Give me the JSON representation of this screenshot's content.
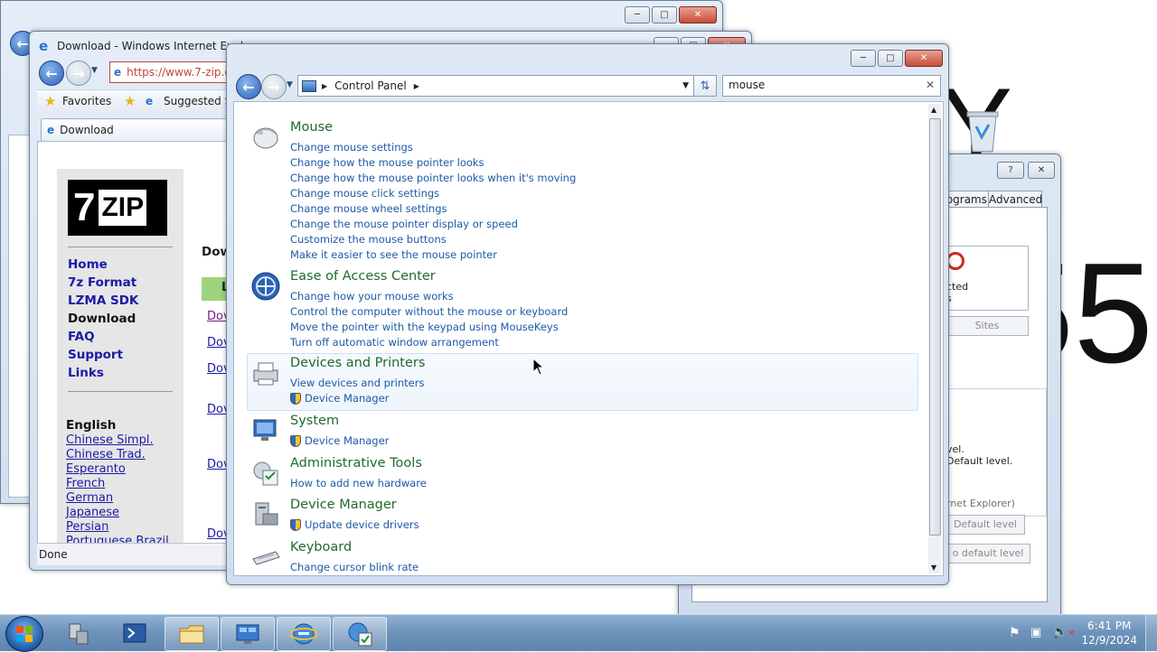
{
  "desktop": {
    "watermark_char_1": "Y",
    "watermark_char_2": "55"
  },
  "back_ie_window": {
    "title": "Download - Windows Internet Explorer"
  },
  "ie_window": {
    "title": "Download - Windows Internet Explorer",
    "address": "https://www.7-zip.o",
    "favorites_label": "Favorites",
    "suggested_label": "Suggested Si",
    "tab_label": "Download",
    "status_text": "Done",
    "page": {
      "heading": "Dow",
      "logo_text_1": "7",
      "logo_text_2": "ZIP",
      "nav": [
        "Home",
        "7z Format",
        "LZMA SDK",
        "Download",
        "FAQ",
        "Support",
        "Links"
      ],
      "language_heading": "English",
      "languages": [
        "Chinese Simpl.",
        "Chinese Trad.",
        "Esperanto",
        "French",
        "German",
        "Japanese",
        "Persian",
        "Portuguese Brazil"
      ],
      "table_header": "L",
      "download_links": [
        "Dov",
        "Dov",
        "Dov",
        "Dov",
        "Dov",
        "Dov"
      ]
    }
  },
  "properties_dialog": {
    "tabs": [
      "ograms",
      "Advanced"
    ],
    "texts": {
      "blocked": "cted",
      "blocked2": "s",
      "sites_button": "Sites",
      "level_1": "vel.",
      "level_2": "Default level.",
      "ie_text": "rnet Explorer)",
      "default_level_button": "Default level",
      "default_level_button2": "o default level"
    }
  },
  "control_panel": {
    "breadcrumb_root": "Control Panel",
    "search_value": "mouse",
    "results": [
      {
        "title": "Mouse",
        "icon": "mouse-icon",
        "links": [
          {
            "text": "Change mouse settings"
          },
          {
            "text": "Change how the mouse pointer looks"
          },
          {
            "text": "Change how the mouse pointer looks when it's moving"
          },
          {
            "text": "Change mouse click settings"
          },
          {
            "text": "Change mouse wheel settings"
          },
          {
            "text": "Change the mouse pointer display or speed"
          },
          {
            "text": "Customize the mouse buttons"
          },
          {
            "text": "Make it easier to see the mouse pointer"
          }
        ]
      },
      {
        "title": "Ease of Access Center",
        "icon": "ease-of-access-icon",
        "links": [
          {
            "text": "Change how your mouse works"
          },
          {
            "text": "Control the computer without the mouse or keyboard"
          },
          {
            "text": "Move the pointer with the keypad using MouseKeys"
          },
          {
            "text": "Turn off automatic window arrangement"
          }
        ]
      },
      {
        "title": "Devices and Printers",
        "icon": "printer-icon",
        "links": [
          {
            "text": "View devices and printers"
          },
          {
            "text": "Device Manager",
            "shield": true
          }
        ]
      },
      {
        "title": "System",
        "icon": "system-icon",
        "links": [
          {
            "text": "Device Manager",
            "shield": true
          }
        ]
      },
      {
        "title": "Administrative Tools",
        "icon": "admin-tools-icon",
        "links": [
          {
            "text": "How to add new hardware"
          }
        ]
      },
      {
        "title": "Device Manager",
        "icon": "device-manager-icon",
        "links": [
          {
            "text": "Update device drivers",
            "shield": true
          }
        ]
      },
      {
        "title": "Keyboard",
        "icon": "keyboard-icon",
        "links": [
          {
            "text": "Change cursor blink rate"
          }
        ]
      }
    ]
  },
  "taskbar": {
    "time": "6:41 PM",
    "date": "12/9/2024"
  }
}
